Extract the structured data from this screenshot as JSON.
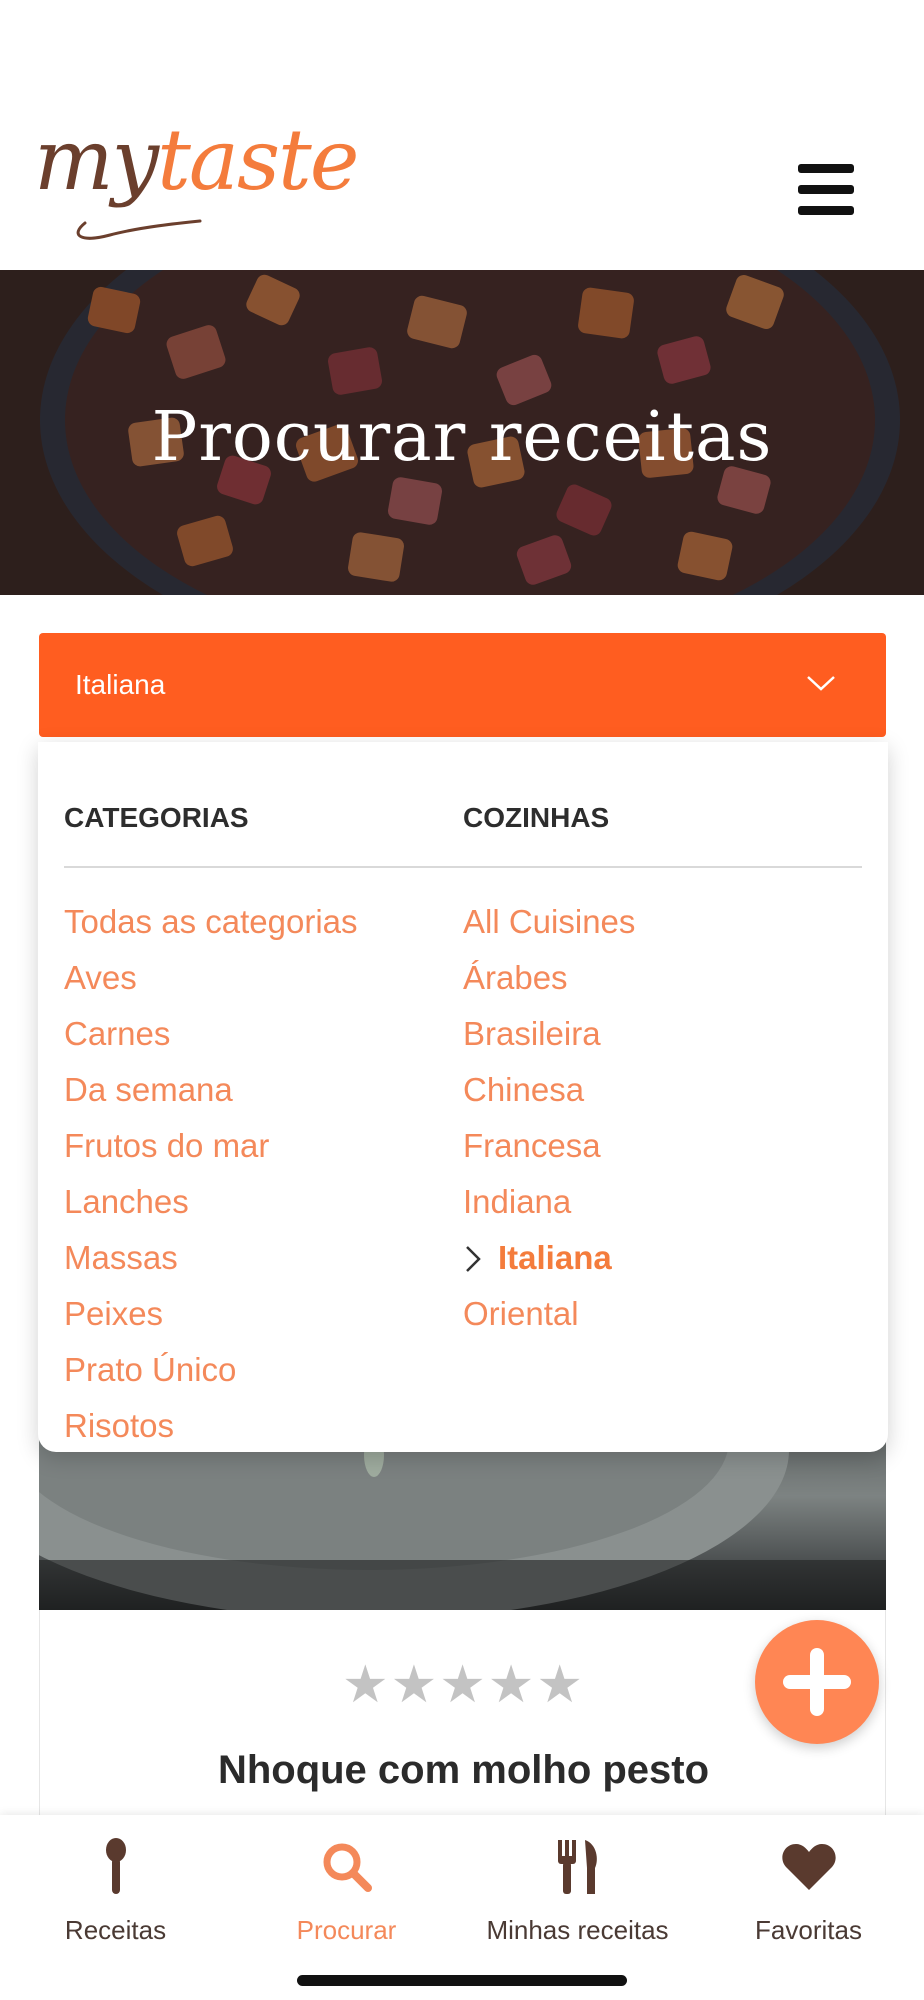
{
  "header": {
    "logo_part1": "my",
    "logo_part2": "taste",
    "menu_icon": "hamburger-menu-icon"
  },
  "hero": {
    "title": "Procurar receitas"
  },
  "filter": {
    "selected_value": "Italiana"
  },
  "dropdown": {
    "categories_heading": "CATEGORIAS",
    "cuisines_heading": "COZINHAS",
    "categories": [
      "Todas as categorias",
      "Aves",
      "Carnes",
      "Da semana",
      "Frutos do mar",
      "Lanches",
      "Massas",
      "Peixes",
      "Prato Único",
      "Risotos"
    ],
    "cuisines": [
      "All Cuisines",
      "Árabes",
      "Brasileira",
      "Chinesa",
      "Francesa",
      "Indiana",
      "Italiana",
      "Oriental"
    ]
  },
  "recipe_card": {
    "stars": "★★★★★",
    "title": "Nhoque com molho pesto"
  },
  "bottom_nav": {
    "items": [
      {
        "label": "Receitas",
        "icon": "spoon-icon"
      },
      {
        "label": "Procurar",
        "icon": "search-icon"
      },
      {
        "label": "Minhas receitas",
        "icon": "utensils-icon"
      },
      {
        "label": "Favoritas",
        "icon": "heart-icon"
      }
    ]
  },
  "colors": {
    "accent": "#ff5d20",
    "link": "#f4895a",
    "brown": "#6b3f2d"
  }
}
